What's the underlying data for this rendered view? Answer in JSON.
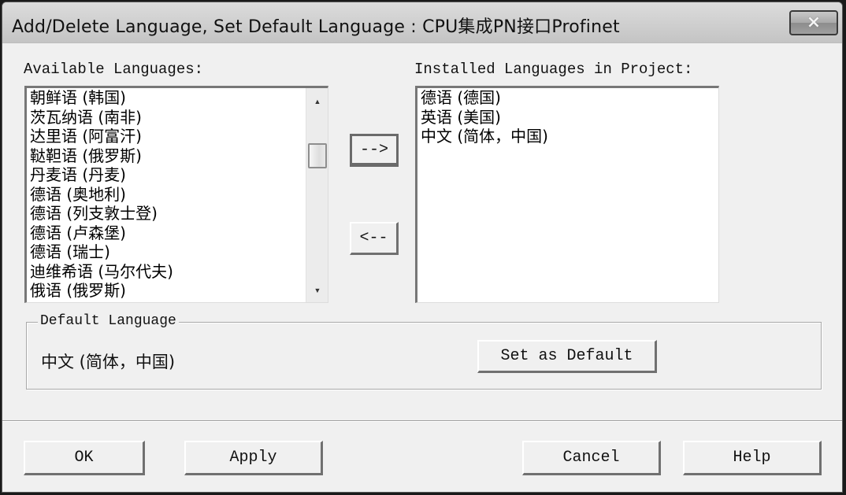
{
  "dialog": {
    "title": "Add/Delete Language, Set Default Language : CPU集成PN接口Profinet",
    "close_icon": "×"
  },
  "available": {
    "label": "Available Languages:",
    "items": [
      "朝鲜语 (韩国)",
      "茨瓦纳语 (南非)",
      "达里语 (阿富汗)",
      "鞑靼语 (俄罗斯)",
      "丹麦语 (丹麦)",
      "德语 (奥地利)",
      "德语 (列支敦士登)",
      "德语 (卢森堡)",
      "德语 (瑞士)",
      "迪维希语 (马尔代夫)",
      "俄语 (俄罗斯)"
    ],
    "scroll_up_icon": "▲",
    "scroll_down_icon": "▼"
  },
  "transfer": {
    "add_label": "-->",
    "remove_label": "<--"
  },
  "installed": {
    "label": "Installed Languages in Project:",
    "items": [
      "德语 (德国)",
      "英语 (美国)",
      "中文 (简体，中国)"
    ]
  },
  "default_language": {
    "group_label": "Default Language",
    "value": "中文 (简体，中国)",
    "set_default_label": "Set as Default"
  },
  "footer": {
    "ok_label": "OK",
    "apply_label": "Apply",
    "cancel_label": "Cancel",
    "help_label": "Help"
  }
}
